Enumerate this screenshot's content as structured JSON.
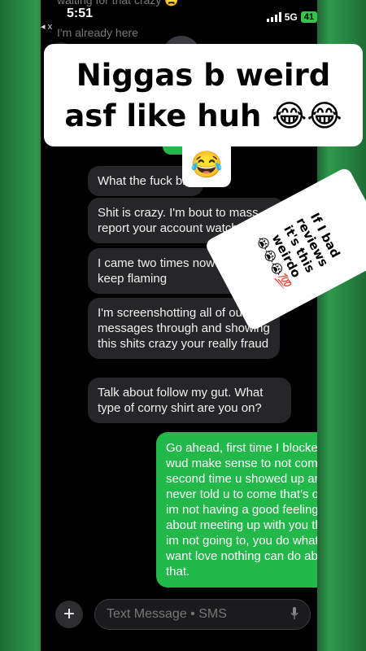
{
  "status": {
    "time": "5:51",
    "back_label": "◂ x",
    "signal": "5G",
    "battery": "41"
  },
  "faded_lines": [
    "waiting for that crazy 😩",
    "I'm already here"
  ],
  "caption": {
    "line1": "Niggas b weird",
    "line2": "asf like huh 😂😂",
    "line3": "😂"
  },
  "sticker": {
    "line1": "If I bad reviews",
    "line2": "it's this weirdo",
    "emojis": "😭😭😭💯"
  },
  "messages_in": [
    "What the fuck bro",
    "Shit is crazy. I'm bout to mass report your account watch.",
    "I came two times now and you keep flaming",
    "I'm screenshotting all of our messages through and showing this shits crazy your really fraud",
    "Talk about follow my gut. What type of corny shirt are you on?"
  ],
  "message_out": "Go ahead, first time I blocked u it wud make sense to not come, second time u showed up and I never told u to come that's on u, if im not having a good feeling about meeting up with you then im not going to, you do what you want love nothing can do about that.",
  "compose": {
    "placeholder": "Text Message • SMS",
    "plus": "+"
  },
  "colors": {
    "incoming": "#262628",
    "outgoing": "#22b84a",
    "background_green": "#2f9a4c"
  },
  "icons": [
    "back-arrow-icon",
    "signal-bars-icon",
    "battery-icon",
    "plus-icon",
    "microphone-icon"
  ]
}
